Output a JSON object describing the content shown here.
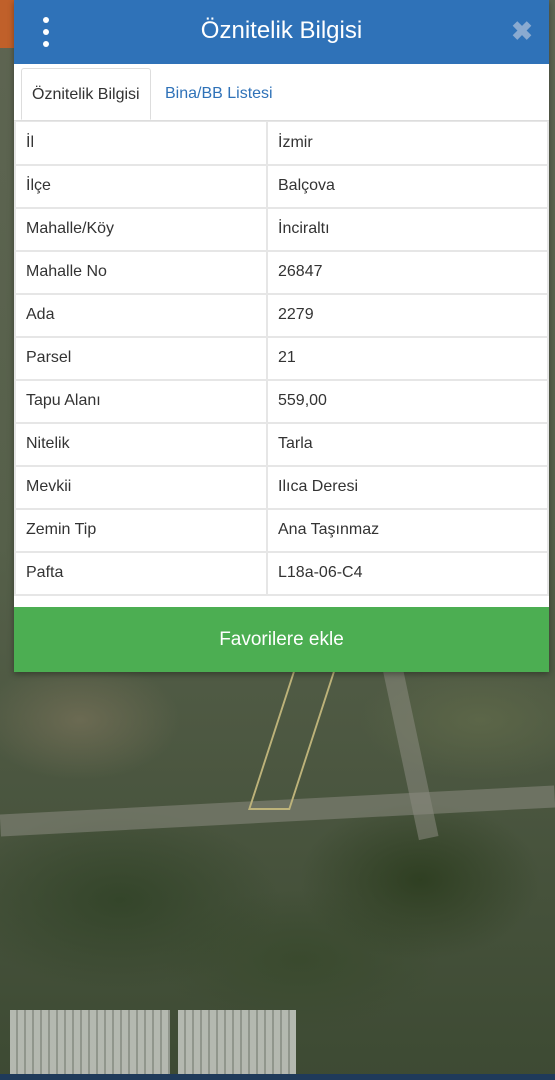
{
  "dialog": {
    "title": "Öznitelik Bilgisi",
    "close_icon": "✖"
  },
  "tabs": [
    {
      "label": "Öznitelik Bilgisi",
      "active": true
    },
    {
      "label": "Bina/BB Listesi",
      "active": false
    }
  ],
  "attributes": [
    {
      "key": "İl",
      "value": "İzmir"
    },
    {
      "key": "İlçe",
      "value": "Balçova"
    },
    {
      "key": "Mahalle/Köy",
      "value": "İnciraltı"
    },
    {
      "key": "Mahalle No",
      "value": "26847"
    },
    {
      "key": "Ada",
      "value": "2279"
    },
    {
      "key": "Parsel",
      "value": "21"
    },
    {
      "key": "Tapu Alanı",
      "value": "559,00"
    },
    {
      "key": "Nitelik",
      "value": "Tarla"
    },
    {
      "key": "Mevkii",
      "value": "Ilıca Deresi"
    },
    {
      "key": "Zemin Tip",
      "value": "Ana Taşınmaz"
    },
    {
      "key": "Pafta",
      "value": "L18a-06-C4"
    }
  ],
  "favorite_button": "Favorilere ekle",
  "icons": {
    "menu": "kebab-menu-icon",
    "close": "close-icon"
  },
  "colors": {
    "header": "#2f72b8",
    "tab_link": "#2f72b8",
    "favorite_button": "#4cae52",
    "parcel_outline": "#bdb37a"
  }
}
